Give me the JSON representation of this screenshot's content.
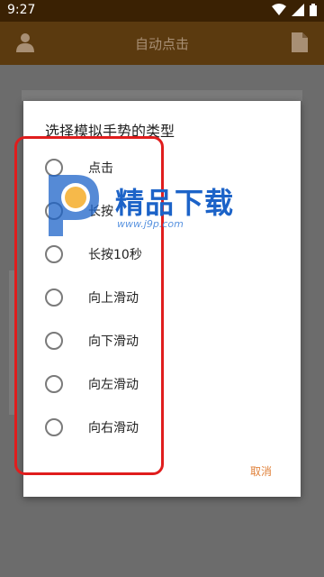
{
  "status_bar": {
    "time": "9:27",
    "wifi_icon": "wifi-icon",
    "signal_icon": "signal-icon",
    "battery_icon": "battery-icon"
  },
  "app_bar": {
    "title": "自动点击",
    "left_icon": "person-icon",
    "right_icon": "document-icon"
  },
  "dialog": {
    "title": "选择模拟手势的类型",
    "options": [
      "点击",
      "长按",
      "长按10秒",
      "向上滑动",
      "向下滑动",
      "向左滑动",
      "向右滑动"
    ],
    "cancel_label": "取消"
  },
  "watermark": {
    "brand": "精品下载",
    "site": "www.j9p.com"
  },
  "colors": {
    "accent": "#e0813a",
    "status_bar": "#3a2103",
    "app_bar": "#5b3a0f",
    "highlight_frame": "#e01d1d",
    "watermark_blue": "#1c63c8"
  }
}
